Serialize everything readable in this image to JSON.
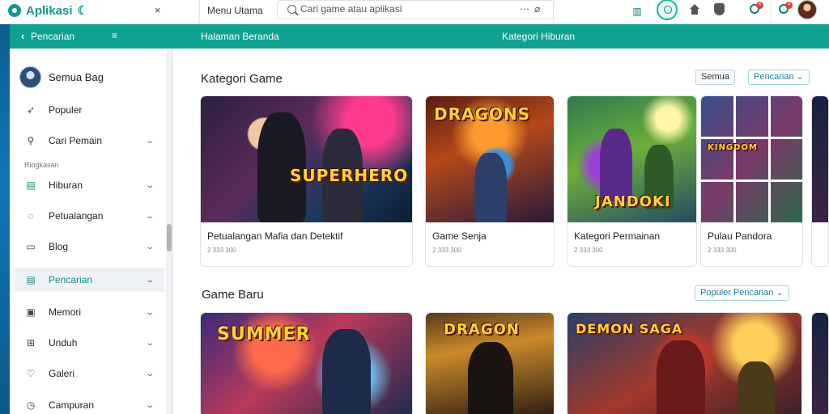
{
  "app": {
    "name": "Aplikasi",
    "search": {
      "placeholder": "Cari game atau aplikasi",
      "more": "⋯"
    },
    "top_menu_label": "Menu Utama",
    "top_icons": [
      "grid-icon",
      "refresh-icon",
      "home-icon",
      "shield-icon",
      "notification-icon",
      "message-icon"
    ],
    "badge_counts": [
      "6",
      "4"
    ]
  },
  "tealbar": {
    "back_label": "Pencarian",
    "menu_glyph": "≡",
    "mid_label": "Halaman Beranda",
    "right_label": "Kategori Hiburan"
  },
  "sidebar": {
    "user_label": "Semua Bag",
    "section_label": "Ringkasan",
    "items": [
      {
        "label": "Populer",
        "icon": "rocket-icon",
        "chevron": false
      },
      {
        "label": "Cari Pemain",
        "icon": "search-icon",
        "chevron": true
      },
      {
        "label": "Hiburan",
        "icon": "calendar-icon",
        "chevron": true
      },
      {
        "label": "Petualangan",
        "icon": "chat-icon",
        "chevron": true
      },
      {
        "label": "Blog",
        "icon": "folder-icon",
        "chevron": true
      },
      {
        "label": "Pencarian",
        "icon": "calendar-icon",
        "chevron": true,
        "active": true
      },
      {
        "label": "Memori",
        "icon": "image-icon",
        "chevron": true
      },
      {
        "label": "Unduh",
        "icon": "grid-icon",
        "chevron": true
      },
      {
        "label": "Galeri",
        "icon": "heart-icon",
        "chevron": true
      },
      {
        "label": "Campuran",
        "icon": "clock-icon",
        "chevron": true
      }
    ]
  },
  "main": {
    "section1": {
      "title": "Kategori Game",
      "pill_left": "Semua",
      "pill_right": "Pencarian",
      "cards": [
        {
          "title": "Petualangan Mafia dan Detektif",
          "meta": "2 333 300",
          "art_text": "SUPERHERO"
        },
        {
          "title": "Game Senja",
          "meta": "2 333 300",
          "art_text": "DRAGONS"
        },
        {
          "title": "Kategori Permainan",
          "meta": "2 333 300",
          "art_text": "JANDOKI"
        },
        {
          "title": "Pulau Pandora",
          "meta": "2 333 300",
          "art_text": "KINGDOM"
        }
      ]
    },
    "section2": {
      "title": "Game Baru",
      "pill": "Populer Pencarian",
      "cards": [
        {
          "art_text": "SUMMER"
        },
        {
          "art_text": "DRAGON"
        },
        {
          "art_text": "DEMON SAGA"
        }
      ]
    }
  }
}
